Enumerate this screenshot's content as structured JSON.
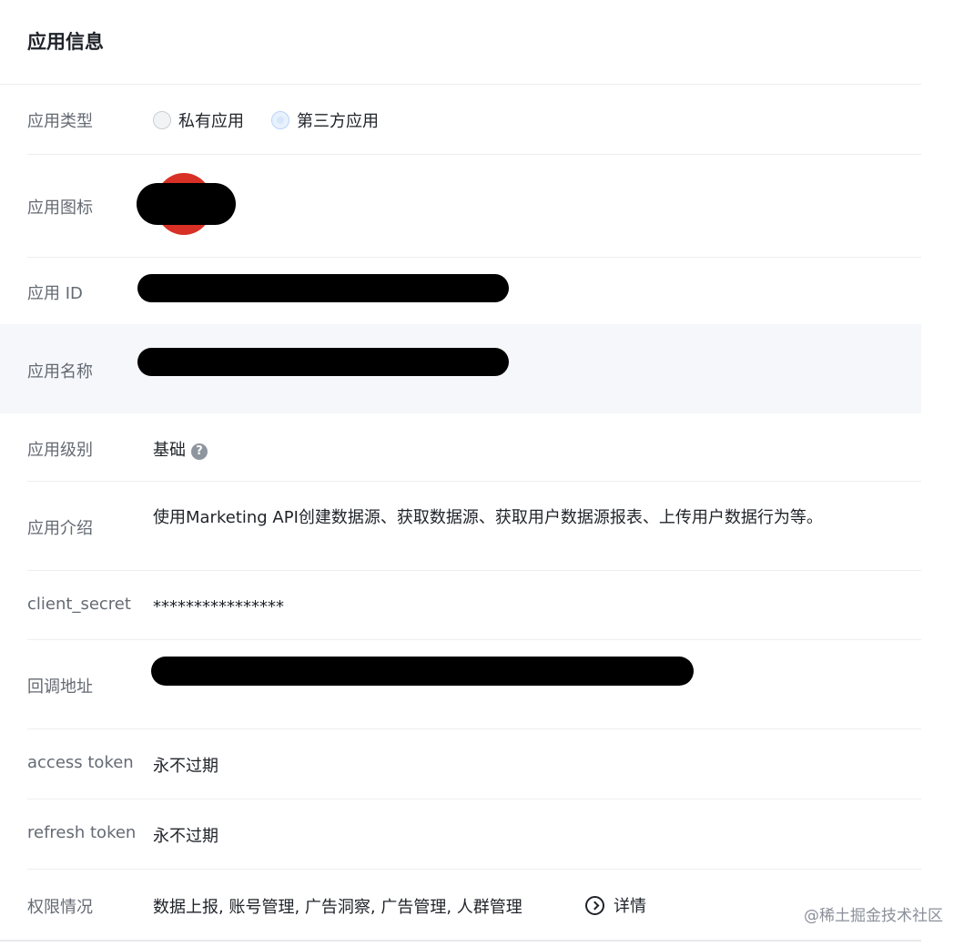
{
  "card": {
    "title": "应用信息"
  },
  "rows": {
    "type": {
      "label": "应用类型",
      "options": [
        {
          "label": "私有应用",
          "selected": false
        },
        {
          "label": "第三方应用",
          "selected": true
        }
      ]
    },
    "icon": {
      "label": "应用图标"
    },
    "app_id": {
      "label": "应用 ID"
    },
    "app_name": {
      "label": "应用名称"
    },
    "level": {
      "label": "应用级别",
      "value": "基础"
    },
    "intro": {
      "label": "应用介绍",
      "value": "使用Marketing API创建数据源、获取数据源、获取用户数据源报表、上传用户数据行为等。"
    },
    "client_secret": {
      "label": "client_secret",
      "value": "****************"
    },
    "callback": {
      "label": "回调地址"
    },
    "access_token": {
      "label": "access token",
      "value": "永不过期"
    },
    "refresh_token": {
      "label": "refresh token",
      "value": "永不过期"
    },
    "permissions": {
      "label": "权限情况",
      "value": "数据上报, 账号管理, 广告洞察, 广告管理, 人群管理",
      "detail_label": "详情"
    }
  },
  "icons": {
    "help": "question-circle-icon",
    "detail": "chevron-right-circle-icon"
  },
  "watermark": "@稀土掘金技术社区",
  "colors": {
    "app_icon": "#d93026",
    "redaction": "#000000",
    "highlight_row": "#f5f7fa"
  }
}
